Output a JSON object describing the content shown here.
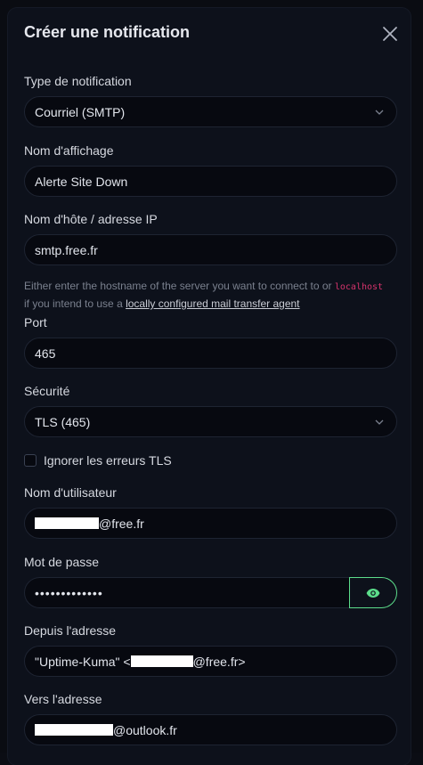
{
  "dialog": {
    "title": "Créer une notification"
  },
  "form": {
    "notification_type": {
      "label": "Type de notification",
      "value": "Courriel (SMTP)"
    },
    "display_name": {
      "label": "Nom d'affichage",
      "value": "Alerte Site Down"
    },
    "hostname": {
      "label": "Nom d'hôte / adresse IP",
      "value": "smtp.free.fr"
    },
    "hostname_help": {
      "text_before": "Either enter the hostname of the server you want to connect to or ",
      "code": "localhost",
      "text_middle": " if you intend to use a ",
      "link": "locally configured mail transfer agent"
    },
    "port": {
      "label": "Port",
      "value": "465"
    },
    "security": {
      "label": "Sécurité",
      "value": "TLS (465)"
    },
    "ignore_tls": {
      "label": "Ignorer les erreurs TLS",
      "checked": false
    },
    "username": {
      "label": "Nom d'utilisateur",
      "value_suffix": "@free.fr"
    },
    "password": {
      "label": "Mot de passe",
      "value": "•••••••••••••"
    },
    "from": {
      "label": "Depuis l'adresse",
      "value_prefix": "\"Uptime-Kuma\" <",
      "value_suffix": "@free.fr>"
    },
    "to": {
      "label": "Vers l'adresse",
      "value_suffix": "@outlook.fr"
    }
  },
  "icons": {
    "close": "close-icon",
    "dropdown": "chevron-down-icon",
    "show_password": "eye-icon"
  },
  "colors": {
    "accent": "#5cdd8b",
    "background": "#0d111b",
    "input_bg": "#070910",
    "code": "#d6336c"
  }
}
